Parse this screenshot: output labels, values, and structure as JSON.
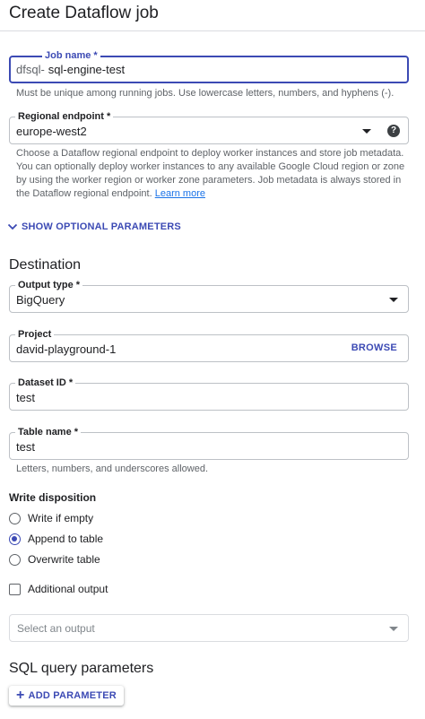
{
  "header": {
    "title": "Create Dataflow job"
  },
  "job_name": {
    "label": "Job name *",
    "prefix": "dfsql-",
    "value": "sql-engine-test",
    "helper": "Must be unique among running jobs. Use lowercase letters, numbers, and hyphens (-)."
  },
  "regional_endpoint": {
    "label": "Regional endpoint *",
    "value": "europe-west2",
    "helper": "Choose a Dataflow regional endpoint to deploy worker instances and store job metadata. You can optionally deploy worker instances to any available Google Cloud region or zone by using the worker region or worker zone parameters. Job metadata is always stored in the Dataflow regional endpoint.",
    "learn_more": "Learn more",
    "help_icon": "?"
  },
  "optional_params": {
    "label": "SHOW OPTIONAL PARAMETERS"
  },
  "destination": {
    "title": "Destination",
    "output_type": {
      "label": "Output type *",
      "value": "BigQuery"
    },
    "project": {
      "label": "Project",
      "value": "david-playground-1",
      "browse": "BROWSE"
    },
    "dataset_id": {
      "label": "Dataset ID *",
      "value": "test"
    },
    "table_name": {
      "label": "Table name *",
      "value": "test",
      "helper": "Letters, numbers, and underscores allowed."
    }
  },
  "write_disposition": {
    "label": "Write disposition",
    "options": [
      {
        "label": "Write if empty",
        "checked": false
      },
      {
        "label": "Append to table",
        "checked": true
      },
      {
        "label": "Overwrite table",
        "checked": false
      }
    ]
  },
  "additional_output": {
    "label": "Additional output",
    "checked": false
  },
  "select_output": {
    "placeholder": "Select an output"
  },
  "sql_params": {
    "title": "SQL query parameters",
    "add_button": "ADD PARAMETER"
  },
  "colors": {
    "accent": "#3c4ab4",
    "link": "#1a73e8",
    "border": "#bdc1c6",
    "helper_text": "#5f6368"
  }
}
